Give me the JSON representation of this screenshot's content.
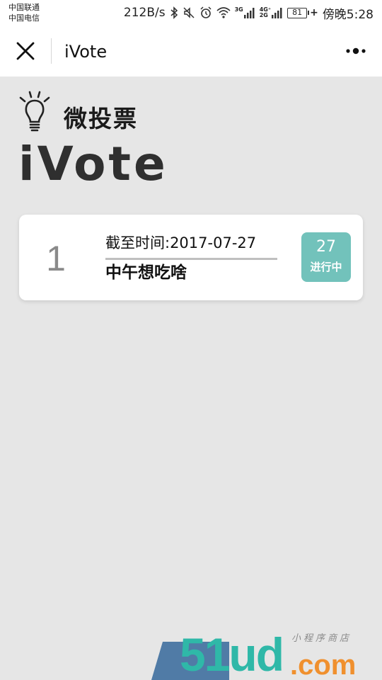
{
  "status_bar": {
    "carrier_1": "中国联通",
    "carrier_2": "中国电信",
    "net_speed": "212B/s",
    "net_3g": "3G",
    "net_4g": "4G⁺",
    "net_2g": "2G",
    "battery": "81",
    "time": "傍晚5:28"
  },
  "nav": {
    "title": "iVote",
    "close_icon": "close-icon",
    "more_icon": "more-icon"
  },
  "header": {
    "icon": "lightbulb-icon",
    "title_cn": "微投票",
    "title_en": "iVote"
  },
  "votes": [
    {
      "index": "1",
      "deadline": "截至时间:2017-07-27",
      "title": "中午想吃啥",
      "badge_count": "27",
      "badge_status": "进行中"
    }
  ],
  "watermark": {
    "main": "51ud",
    "domain": ".com",
    "tagline": "小程序商店"
  },
  "colors": {
    "background": "#e6e6e6",
    "badge": "#72c2bb",
    "watermark_teal": "#2fb8a8",
    "watermark_orange": "#f0902e"
  }
}
